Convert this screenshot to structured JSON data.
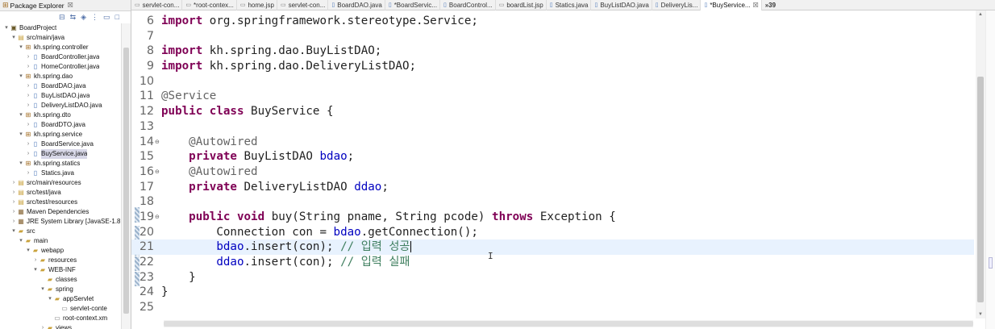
{
  "explorer": {
    "title": "Package Explorer",
    "close": "☒",
    "tree": [
      {
        "indent": 0,
        "arrow": "▾",
        "icon": "project",
        "glyph": "▣",
        "label": "BoardProject"
      },
      {
        "indent": 1,
        "arrow": "▾",
        "icon": "folder",
        "glyph": "▤",
        "label": "src/main/java"
      },
      {
        "indent": 2,
        "arrow": "▾",
        "icon": "package",
        "glyph": "⊞",
        "label": "kh.spring.controller"
      },
      {
        "indent": 3,
        "arrow": "›",
        "icon": "java",
        "glyph": "▯",
        "label": "BoardController.java"
      },
      {
        "indent": 3,
        "arrow": "›",
        "icon": "java",
        "glyph": "▯",
        "label": "HomeController.java"
      },
      {
        "indent": 2,
        "arrow": "▾",
        "icon": "package",
        "glyph": "⊞",
        "label": "kh.spring.dao"
      },
      {
        "indent": 3,
        "arrow": "›",
        "icon": "java",
        "glyph": "▯",
        "label": "BoardDAO.java"
      },
      {
        "indent": 3,
        "arrow": "›",
        "icon": "java",
        "glyph": "▯",
        "label": "BuyListDAO.java"
      },
      {
        "indent": 3,
        "arrow": "›",
        "icon": "java",
        "glyph": "▯",
        "label": "DeliveryListDAO.java"
      },
      {
        "indent": 2,
        "arrow": "▾",
        "icon": "package",
        "glyph": "⊞",
        "label": "kh.spring.dto"
      },
      {
        "indent": 3,
        "arrow": "›",
        "icon": "java",
        "glyph": "▯",
        "label": "BoardDTO.java"
      },
      {
        "indent": 2,
        "arrow": "▾",
        "icon": "package",
        "glyph": "⊞",
        "label": "kh.spring.service"
      },
      {
        "indent": 3,
        "arrow": "›",
        "icon": "java",
        "glyph": "▯",
        "label": "BoardService.java"
      },
      {
        "indent": 3,
        "arrow": "›",
        "icon": "java",
        "glyph": "▯",
        "label": "BuyService.java",
        "selected": true
      },
      {
        "indent": 2,
        "arrow": "▾",
        "icon": "package",
        "glyph": "⊞",
        "label": "kh.spring.statics"
      },
      {
        "indent": 3,
        "arrow": "›",
        "icon": "java",
        "glyph": "▯",
        "label": "Statics.java"
      },
      {
        "indent": 1,
        "arrow": "›",
        "icon": "folder",
        "glyph": "▤",
        "label": "src/main/resources"
      },
      {
        "indent": 1,
        "arrow": "›",
        "icon": "folder",
        "glyph": "▤",
        "label": "src/test/java"
      },
      {
        "indent": 1,
        "arrow": "›",
        "icon": "folder",
        "glyph": "▤",
        "label": "src/test/resources"
      },
      {
        "indent": 1,
        "arrow": "›",
        "icon": "lib",
        "glyph": "▦",
        "label": "Maven Dependencies"
      },
      {
        "indent": 1,
        "arrow": "›",
        "icon": "lib",
        "glyph": "▦",
        "label": "JRE System Library [JavaSE-1.8"
      },
      {
        "indent": 1,
        "arrow": "▾",
        "icon": "folder",
        "glyph": "▰",
        "label": "src"
      },
      {
        "indent": 2,
        "arrow": "▾",
        "icon": "folder",
        "glyph": "▰",
        "label": "main"
      },
      {
        "indent": 3,
        "arrow": "▾",
        "icon": "folder",
        "glyph": "▰",
        "label": "webapp"
      },
      {
        "indent": 4,
        "arrow": "›",
        "icon": "folder",
        "glyph": "▰",
        "label": "resources"
      },
      {
        "indent": 4,
        "arrow": "▾",
        "icon": "folder",
        "glyph": "▰",
        "label": "WEB-INF"
      },
      {
        "indent": 5,
        "arrow": "",
        "icon": "folder",
        "glyph": "▰",
        "label": "classes"
      },
      {
        "indent": 5,
        "arrow": "▾",
        "icon": "folder",
        "glyph": "▰",
        "label": "spring"
      },
      {
        "indent": 6,
        "arrow": "▾",
        "icon": "folder",
        "glyph": "▰",
        "label": "appServlet"
      },
      {
        "indent": 7,
        "arrow": "",
        "icon": "file",
        "glyph": "▭",
        "label": "servlet-conte"
      },
      {
        "indent": 6,
        "arrow": "",
        "icon": "file",
        "glyph": "▭",
        "label": "root-context.xm"
      },
      {
        "indent": 5,
        "arrow": "›",
        "icon": "folder",
        "glyph": "▰",
        "label": "views"
      }
    ]
  },
  "tabs": [
    {
      "label": "servlet-con...",
      "glyph": "▭",
      "active": false
    },
    {
      "label": "*root-contex...",
      "glyph": "▭",
      "active": false
    },
    {
      "label": "home.jsp",
      "glyph": "▭",
      "active": false
    },
    {
      "label": "servlet-con...",
      "glyph": "▭",
      "active": false
    },
    {
      "label": "BoardDAO.java",
      "glyph": "▯",
      "active": false
    },
    {
      "label": "*BoardServic...",
      "glyph": "▯",
      "active": false
    },
    {
      "label": "BoardControl...",
      "glyph": "▯",
      "active": false
    },
    {
      "label": "boardList.jsp",
      "glyph": "▭",
      "active": false
    },
    {
      "label": "Statics.java",
      "glyph": "▯",
      "active": false
    },
    {
      "label": "BuyListDAO.java",
      "glyph": "▯",
      "active": false
    },
    {
      "label": "DeliveryLis...",
      "glyph": "▯",
      "active": false
    },
    {
      "label": "*BuyService...",
      "glyph": "▯",
      "active": true,
      "close": "☒"
    }
  ],
  "tab_overflow": "»39",
  "editor": {
    "lines": [
      {
        "n": "6",
        "fold": "",
        "current": false,
        "parts": [
          [
            "kw",
            "import"
          ],
          [
            "",
            "org.springframework.stereotype.Service;"
          ]
        ]
      },
      {
        "n": "7",
        "fold": "",
        "current": false,
        "parts": []
      },
      {
        "n": "8",
        "fold": "",
        "current": false,
        "parts": [
          [
            "kw",
            "import"
          ],
          [
            "",
            "kh.spring.dao.BuyListDAO;"
          ]
        ]
      },
      {
        "n": "9",
        "fold": "",
        "current": false,
        "parts": [
          [
            "kw",
            "import"
          ],
          [
            "",
            "kh.spring.dao.DeliveryListDAO;"
          ]
        ]
      },
      {
        "n": "10",
        "fold": "",
        "current": false,
        "parts": []
      },
      {
        "n": "11",
        "fold": "",
        "current": false,
        "parts": [
          [
            "ann",
            "@Service"
          ]
        ]
      },
      {
        "n": "12",
        "fold": "",
        "current": false,
        "parts": [
          [
            "kw",
            "public class"
          ],
          [
            "",
            "BuyService {"
          ]
        ]
      },
      {
        "n": "13",
        "fold": "",
        "current": false,
        "parts": []
      },
      {
        "n": "14",
        "fold": "⊖",
        "current": false,
        "parts": [
          [
            "",
            "    "
          ],
          [
            "ann",
            "@Autowired"
          ]
        ]
      },
      {
        "n": "15",
        "fold": "",
        "current": false,
        "parts": [
          [
            "",
            "    "
          ],
          [
            "kw",
            "private"
          ],
          [
            "",
            "BuyListDAO "
          ],
          [
            "fld",
            "bdao"
          ],
          [
            "",
            ";"
          ]
        ]
      },
      {
        "n": "16",
        "fold": "⊖",
        "current": false,
        "parts": [
          [
            "",
            "    "
          ],
          [
            "ann",
            "@Autowired"
          ]
        ]
      },
      {
        "n": "17",
        "fold": "",
        "current": false,
        "parts": [
          [
            "",
            "    "
          ],
          [
            "kw",
            "private"
          ],
          [
            "",
            "DeliveryListDAO "
          ],
          [
            "fld",
            "ddao"
          ],
          [
            "",
            ";"
          ]
        ]
      },
      {
        "n": "18",
        "fold": "",
        "current": false,
        "parts": []
      },
      {
        "n": "19",
        "fold": "⊖",
        "current": false,
        "parts": [
          [
            "",
            "    "
          ],
          [
            "kw",
            "public void"
          ],
          [
            "",
            "buy(String pname, String pcode) "
          ],
          [
            "kw",
            "throws"
          ],
          [
            "",
            "Exception {"
          ]
        ]
      },
      {
        "n": "20",
        "fold": "",
        "current": false,
        "parts": [
          [
            "",
            "        Connection con = "
          ],
          [
            "fld",
            "bdao"
          ],
          [
            "",
            ".getConnection();"
          ]
        ]
      },
      {
        "n": "21",
        "fold": "",
        "current": true,
        "parts": [
          [
            "",
            "        "
          ],
          [
            "fld",
            "bdao"
          ],
          [
            "",
            ".insert(con); "
          ],
          [
            "cmt",
            "// 입력 성공"
          ],
          [
            "caret",
            ""
          ]
        ]
      },
      {
        "n": "22",
        "fold": "",
        "current": false,
        "parts": [
          [
            "",
            "        "
          ],
          [
            "fld",
            "ddao"
          ],
          [
            "",
            ".insert(con); "
          ],
          [
            "cmt",
            "// 입력 실패"
          ]
        ]
      },
      {
        "n": "23",
        "fold": "",
        "current": false,
        "parts": [
          [
            "",
            "    }"
          ]
        ]
      },
      {
        "n": "24",
        "fold": "",
        "current": false,
        "parts": [
          [
            "",
            "}"
          ]
        ]
      },
      {
        "n": "25",
        "fold": "",
        "current": false,
        "parts": []
      }
    ]
  },
  "colors": {
    "keyword": "#7f0055",
    "annotation": "#646464",
    "field": "#0000c0",
    "comment": "#3f7f5f",
    "current_line": "#e8f2fe"
  }
}
